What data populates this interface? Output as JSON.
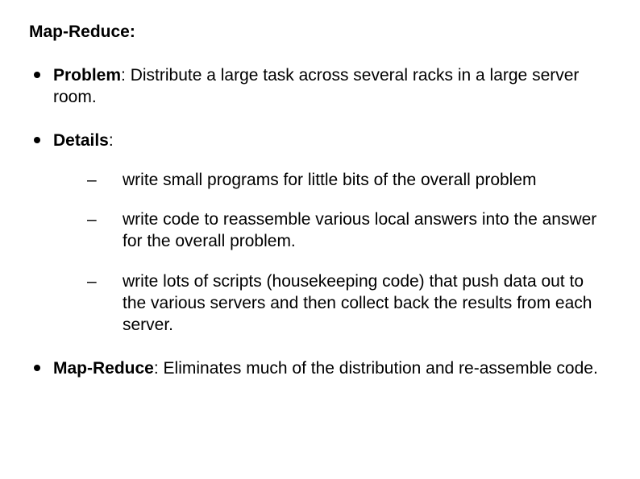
{
  "title": "Map-Reduce:",
  "bullets": [
    {
      "lead": "Problem",
      "text": ": Distribute a large task across several racks in a large server room."
    },
    {
      "lead": "Details",
      "text": ":",
      "sub": [
        "write small programs for little bits of the overall problem",
        "write code to reassemble various local answers into the answer for the overall problem.",
        "write lots of scripts (housekeeping code) that push data out to the various servers and then collect back the results from each server."
      ]
    },
    {
      "lead": "Map-Reduce",
      "text": ": Eliminates much of the distribution and re-assemble code."
    }
  ]
}
